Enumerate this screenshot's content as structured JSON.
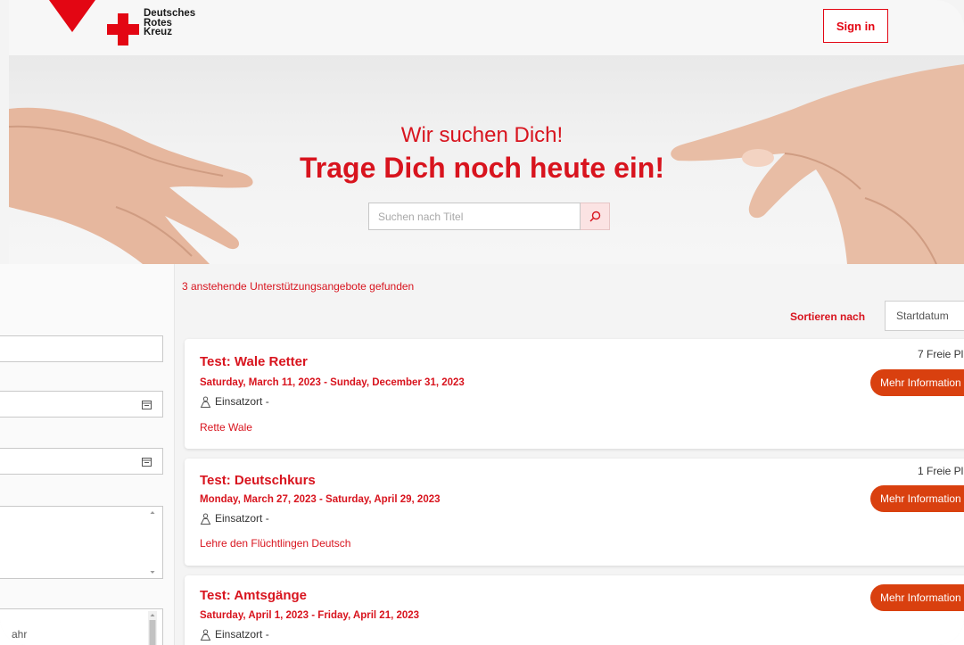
{
  "header": {
    "logo_lines": [
      "Deutsches",
      "Rotes",
      "Kreuz"
    ],
    "signin_label": "Sign in"
  },
  "hero": {
    "subtitle": "Wir suchen Dich!",
    "title": "Trage Dich noch heute ein!",
    "search_placeholder": "Suchen nach Titel"
  },
  "results": {
    "found_text": "3 anstehende Unterstützungsangebote gefunden",
    "sort_label": "Sortieren nach",
    "sort_value": "Startdatum"
  },
  "sidebar": {
    "partial_text": "ahr"
  },
  "cards": [
    {
      "title": "Test: Wale Retter",
      "dates": "Saturday, March 11, 2023 - Sunday, December 31, 2023",
      "location": "Einsatzort -",
      "description": "Rette Wale",
      "free": "7 Freie Pl",
      "button": "Mehr Information"
    },
    {
      "title": "Test: Deutschkurs",
      "dates": "Monday, March 27, 2023 - Saturday, April 29, 2023",
      "location": "Einsatzort -",
      "description": "Lehre den Flüchtlingen Deutsch",
      "free": "1 Freie Pl",
      "button": "Mehr Information"
    },
    {
      "title": "Test: Amtsgänge",
      "dates": "Saturday, April 1, 2023 - Friday, April 21, 2023",
      "location": "Einsatzort -",
      "button": "Mehr Information"
    }
  ],
  "colors": {
    "brand_red": "#e30613",
    "text_red": "#d8141e",
    "button_orange": "#d9400f"
  }
}
